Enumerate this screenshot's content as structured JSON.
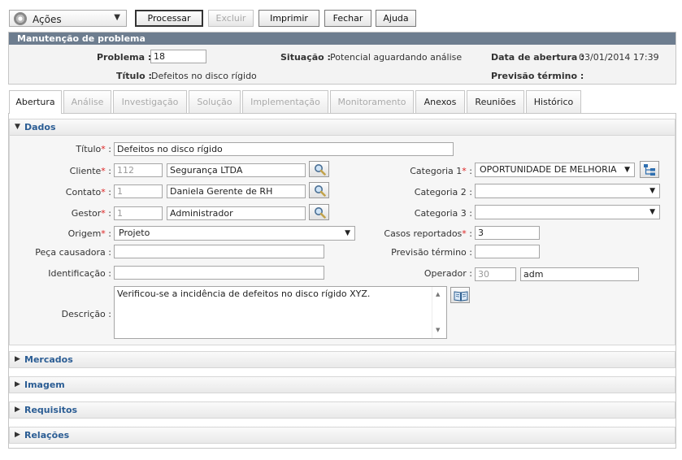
{
  "toolbar": {
    "actions_label": "Ações",
    "actions_icon": "gear-icon",
    "processar": "Processar",
    "excluir": "Excluir",
    "imprimir": "Imprimir",
    "fechar": "Fechar",
    "ajuda": "Ajuda"
  },
  "header": {
    "title": "Manutenção de problema",
    "problema_label": "Problema :",
    "problema_value": "18",
    "situacao_label": "Situação :",
    "situacao_value": "Potencial aguardando análise",
    "data_abertura_label": "Data de abertura :",
    "data_abertura_value": "03/01/2014 17:39",
    "titulo_label": "Título :",
    "titulo_value": "Defeitos no disco rígido",
    "previsao_label": "Previsão término :",
    "previsao_value": ""
  },
  "tabs": [
    {
      "label": "Abertura",
      "state": "active"
    },
    {
      "label": "Análise",
      "state": "disabled"
    },
    {
      "label": "Investigação",
      "state": "disabled"
    },
    {
      "label": "Solução",
      "state": "disabled"
    },
    {
      "label": "Implementação",
      "state": "disabled"
    },
    {
      "label": "Monitoramento",
      "state": "disabled"
    },
    {
      "label": "Anexos",
      "state": "enabled"
    },
    {
      "label": "Reuniões",
      "state": "enabled"
    },
    {
      "label": "Histórico",
      "state": "enabled"
    }
  ],
  "dados": {
    "section_title": "Dados",
    "required_mark": "*",
    "colon": ":",
    "titulo_label": "Título",
    "titulo_value": "Defeitos no disco rígido",
    "cliente_label": "Cliente",
    "cliente_code": "112",
    "cliente_name": "Segurança LTDA",
    "contato_label": "Contato",
    "contato_code": "1",
    "contato_name": "Daniela Gerente de RH",
    "gestor_label": "Gestor",
    "gestor_code": "1",
    "gestor_name": "Administrador",
    "origem_label": "Origem",
    "origem_value": "Projeto",
    "peca_label": "Peça causadora :",
    "peca_value": "",
    "identificacao_label": "Identificação :",
    "identificacao_value": "",
    "descricao_label": "Descrição :",
    "descricao_value": "Verificou-se a incidência de defeitos no disco rígido XYZ.",
    "categoria1_label": "Categoria 1",
    "categoria1_value": "OPORTUNIDADE DE MELHORIA",
    "categoria2_label": "Categoria 2 :",
    "categoria2_value": "",
    "categoria3_label": "Categoria 3 :",
    "categoria3_value": "",
    "casos_label": "Casos reportados",
    "casos_value": "3",
    "previsao_label": "Previsão término :",
    "previsao_value": "",
    "operador_label": "Operador :",
    "operador_code": "30",
    "operador_name": "adm"
  },
  "sections": [
    {
      "title": "Mercados"
    },
    {
      "title": "Imagem"
    },
    {
      "title": "Requisitos"
    },
    {
      "title": "Relações"
    }
  ],
  "colors": {
    "header_bar": "#6d7d8f",
    "section_title": "#2b5d94",
    "required": "#d22222"
  }
}
